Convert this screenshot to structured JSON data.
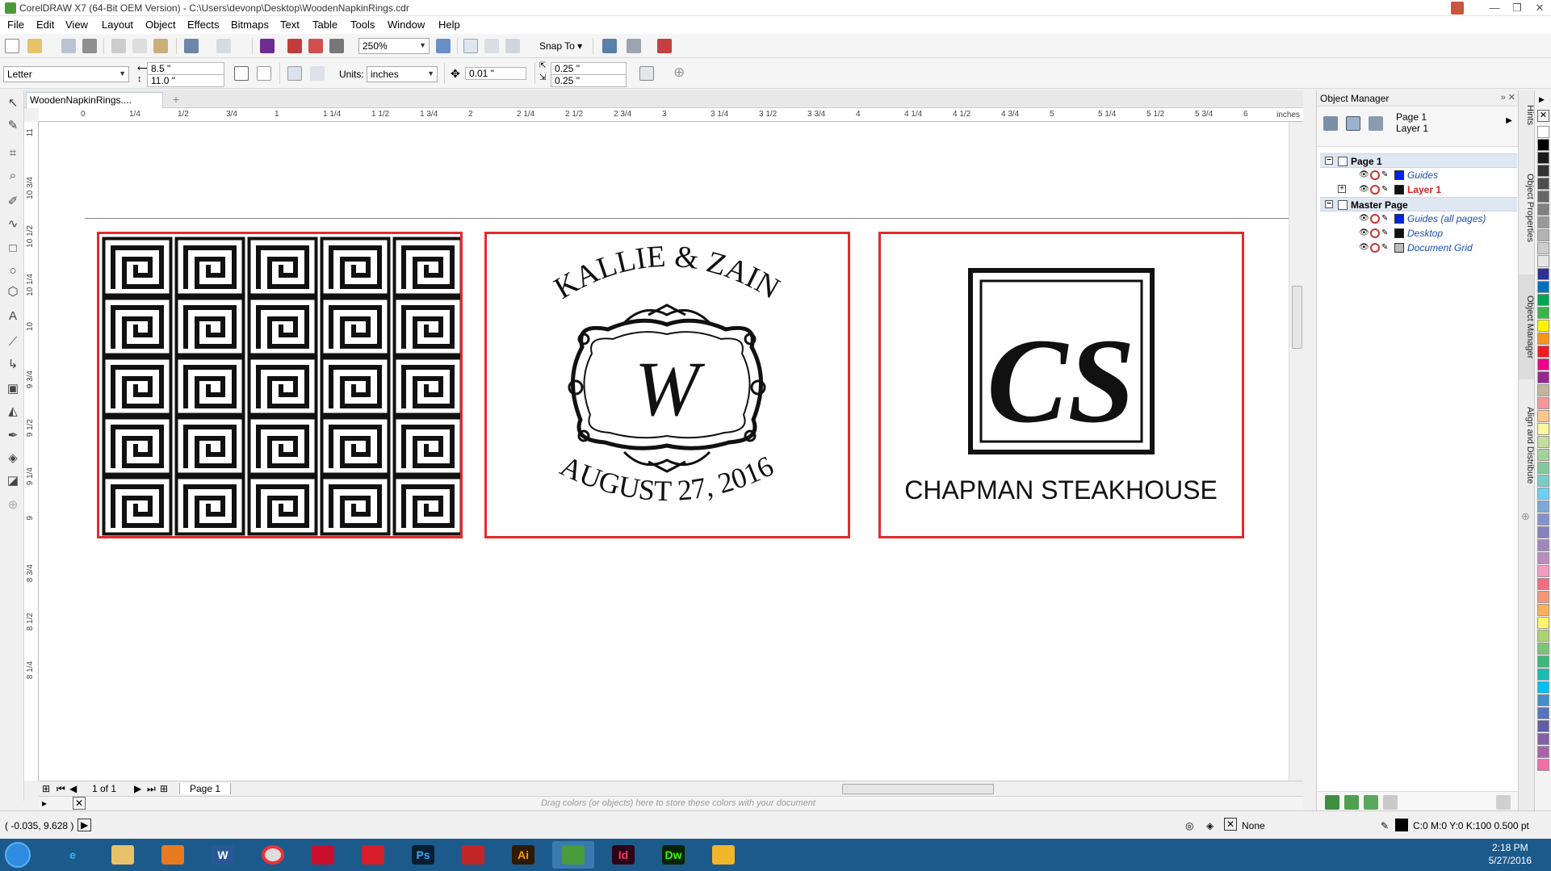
{
  "window": {
    "title": "CorelDRAW X7 (64-Bit OEM Version) - C:\\Users\\devonp\\Desktop\\WoodenNapkinRings.cdr",
    "controls": [
      "—",
      "❐",
      "✕"
    ]
  },
  "menu": [
    "File",
    "Edit",
    "View",
    "Layout",
    "Object",
    "Effects",
    "Bitmaps",
    "Text",
    "Table",
    "Tools",
    "Window",
    "Help"
  ],
  "toolbar1": {
    "zoom": "250%",
    "snap_to": "Snap To"
  },
  "toolbar2": {
    "page_size": "Letter",
    "width": "8.5 \"",
    "height": "11.0 \"",
    "units_label": "Units:",
    "units": "inches",
    "nudge": "0.01 \"",
    "dup_x": "0.25 \"",
    "dup_y": "0.25 \""
  },
  "document_tab": "WoodenNapkinRings....",
  "ruler": {
    "unit": "inches",
    "h_ticks": [
      "0",
      "1/4",
      "1/2",
      "3/4",
      "1",
      "1 1/4",
      "1 1/2",
      "1 3/4",
      "2",
      "2 1/4",
      "2 1/2",
      "2 3/4",
      "3",
      "3 1/4",
      "3 1/2",
      "3 3/4",
      "4",
      "4 1/4",
      "4 1/2",
      "4 3/4",
      "5",
      "5 1/4",
      "5 1/2",
      "5 3/4",
      "6"
    ],
    "v_ticks": [
      "11",
      "10 3/4",
      "10 1/2",
      "10 1/4",
      "10",
      "9 3/4",
      "9 1/2",
      "9 1/4",
      "9",
      "8 3/4",
      "8 1/2",
      "8 1/4"
    ]
  },
  "artwork": {
    "panel2": {
      "top_text": "KALLIE & ZAIN",
      "monogram": "W",
      "bottom_text": "AUGUST 27, 2016"
    },
    "panel3": {
      "monogram": "CS",
      "caption": "CHAPMAN STEAKHOUSE"
    },
    "frame_color": "#e32b2b"
  },
  "page_nav": {
    "position": "1 of 1",
    "page_tab": "Page 1"
  },
  "palette_hint": "Drag colors (or objects) here to store these colors with your document",
  "status": {
    "coords": "( -0.035, 9.628 )",
    "fill": "None",
    "outline": "C:0 M:0 Y:0 K:100  0.500 pt"
  },
  "object_manager": {
    "title": "Object Manager",
    "current_page": "Page 1",
    "current_layer": "Layer 1",
    "tree": [
      {
        "type": "page",
        "name": "Page 1"
      },
      {
        "type": "layer",
        "name": "Guides",
        "color": "#0022ee",
        "name_color": "#1a4fb8"
      },
      {
        "type": "layer",
        "name": "Layer 1",
        "color": "#111111",
        "name_color": "#e01c1c",
        "expandable": true
      },
      {
        "type": "page",
        "name": "Master Page"
      },
      {
        "type": "layer",
        "name": "Guides (all pages)",
        "color": "#0022ee",
        "name_color": "#1a4fb8"
      },
      {
        "type": "layer",
        "name": "Desktop",
        "color": "#111111",
        "name_color": "#1a4fb8"
      },
      {
        "type": "layer",
        "name": "Document Grid",
        "color": "#bbbbbb",
        "name_color": "#1a4fb8"
      }
    ]
  },
  "docker_tabs": [
    "Hints",
    "Object Properties",
    "Object Manager",
    "Align and Distribute"
  ],
  "palette_colors": [
    "#ffffff",
    "#000000",
    "#1a1a1a",
    "#333333",
    "#4d4d4d",
    "#666666",
    "#808080",
    "#999999",
    "#b3b3b3",
    "#cccccc",
    "#e6e6e6",
    "#2e3192",
    "#0072bc",
    "#00a651",
    "#39b54a",
    "#fff200",
    "#f7941d",
    "#ed1c24",
    "#ec008c",
    "#92278f",
    "#c2b59b",
    "#f5989d",
    "#fdc68a",
    "#fff799",
    "#c4df9b",
    "#a3d39c",
    "#82ca9c",
    "#7accc8",
    "#6dcff6",
    "#7da7d9",
    "#8393ca",
    "#8781bd",
    "#a187be",
    "#bd8cbf",
    "#f49ac1",
    "#f26d7d",
    "#f69679",
    "#fbaf5d",
    "#fff568",
    "#acd373",
    "#7cc576",
    "#3bb878",
    "#1abbb4",
    "#00bff3",
    "#448ccb",
    "#5674b9",
    "#605ca8",
    "#8560a8",
    "#a864a8",
    "#f06eaa"
  ],
  "clock": {
    "time": "2:18 PM",
    "date": "5/27/2016"
  }
}
